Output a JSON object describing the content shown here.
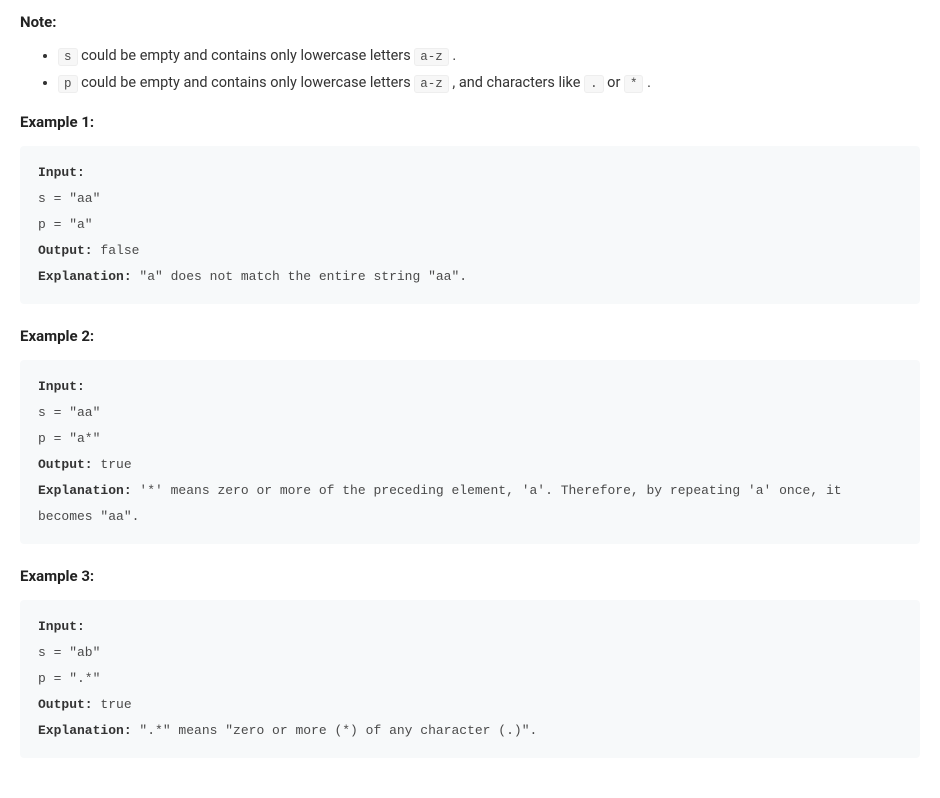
{
  "note": {
    "heading": "Note:",
    "items": [
      {
        "var": "s",
        "prefix": " could be empty and contains only lowercase letters ",
        "code1": "a-z",
        "suffix": " ."
      },
      {
        "var": "p",
        "prefix": " could be empty and contains only lowercase letters ",
        "code1": "a-z",
        "mid": " , and characters like ",
        "code2": ".",
        "mid2": " or ",
        "code3": "*",
        "suffix": " ."
      }
    ]
  },
  "labels": {
    "input": "Input:",
    "output": "Output:",
    "explanation": "Explanation:"
  },
  "examples": [
    {
      "title": "Example 1:",
      "s": "s = \"aa\"",
      "p": "p = \"a\"",
      "output_val": " false",
      "explanation_val": " \"a\" does not match the entire string \"aa\"."
    },
    {
      "title": "Example 2:",
      "s": "s = \"aa\"",
      "p": "p = \"a*\"",
      "output_val": " true",
      "explanation_val": " '*' means zero or more of the preceding element, 'a'. Therefore, by repeating 'a' once, it becomes \"aa\"."
    },
    {
      "title": "Example 3:",
      "s": "s = \"ab\"",
      "p": "p = \".*\"",
      "output_val": " true",
      "explanation_val": " \".*\" means \"zero or more (*) of any character (.)\"."
    }
  ]
}
